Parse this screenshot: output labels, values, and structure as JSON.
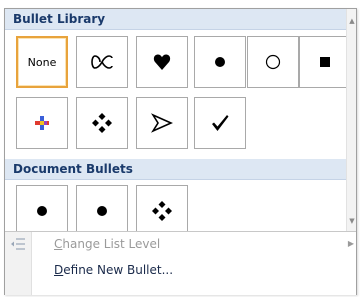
{
  "sections": {
    "library_title": "Bullet Library",
    "document_title": "Document Bullets"
  },
  "tiles": {
    "none_label": "None"
  },
  "menu": {
    "change_level": {
      "mnemonic": "C",
      "rest": "hange List Level"
    },
    "define_bullet": {
      "mnemonic": "D",
      "rest": "efine New Bullet..."
    }
  },
  "colors": {
    "header_bg": "#dde7f3",
    "header_text": "#1a3a6b",
    "selected_border": "#e8a33c"
  },
  "icons": {
    "library": [
      "none",
      "proportional-symbol",
      "heart",
      "filled-circle",
      "hollow-circle",
      "filled-square",
      "color-plus",
      "four-diamonds",
      "arrowhead",
      "checkmark"
    ],
    "document": [
      "filled-circle",
      "filled-circle",
      "four-diamonds"
    ],
    "menu": [
      "change-list-level-icon",
      "submenu-arrow-icon"
    ]
  }
}
